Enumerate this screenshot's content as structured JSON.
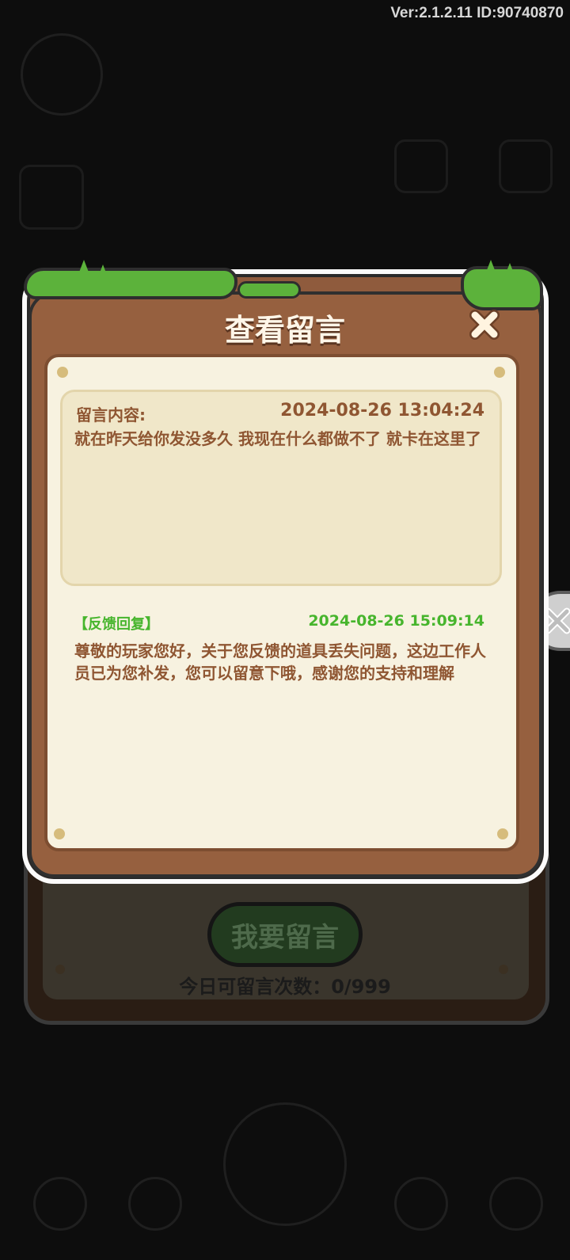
{
  "status": {
    "version_text": "Ver:2.1.2.11 ID:90740870"
  },
  "dialog": {
    "title": "查看留言",
    "close_icon": "close-x-icon",
    "message": {
      "label": "留言内容:",
      "timestamp": "2024-08-26 13:04:24",
      "body": "就在昨天给你发没多久  我现在什么都做不了  就卡在这里了"
    },
    "reply": {
      "label": "【反馈回复】",
      "timestamp": "2024-08-26 15:09:14",
      "body": "尊敬的玩家您好，关于您反馈的道具丢失问题，这边工作人员已为您补发，您可以留意下哦，感谢您的支持和理解"
    }
  },
  "background_panel": {
    "button_label": "我要留言",
    "count_text": "今日可留言次数：0/999"
  },
  "colors": {
    "wood": "#96603f",
    "paper": "#f7f2e0",
    "grass": "#5cb23b",
    "text_brown": "#8f5632",
    "reply_green": "#47b52d"
  }
}
